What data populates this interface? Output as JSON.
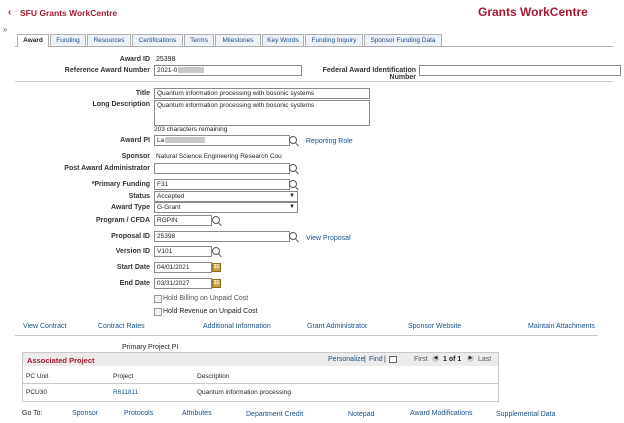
{
  "header": {
    "back_icon": "chevron-left-icon",
    "app_title": "SFU Grants WorkCentre",
    "right_title": "Grants WorkCentre",
    "collapse_glyph": "»",
    "brand_color": "#a6192e"
  },
  "tabs": [
    "Award",
    "Funding",
    "Resources",
    "Certifications",
    "Terms",
    "Milestones",
    "Key Words",
    "Funding Inquiry",
    "Sponsor Funding Data"
  ],
  "award": {
    "award_id_label": "Award ID",
    "award_id": "25398",
    "reference_label": "Reference Award Number",
    "reference_value": "2021-0",
    "federal_label": "Federal Award Identification Number",
    "federal_value": "",
    "title_label": "Title",
    "title_value": "Quantum information processing with bosonic systems",
    "long_desc_label": "Long Description",
    "long_desc_value": "Quantum information processing with bosonic systems",
    "chars_remaining": "203 characters remaining",
    "award_pi_label": "Award PI",
    "award_pi_value": "La",
    "reporting_role_link": "Reporting Role",
    "sponsor_label": "Sponsor",
    "sponsor_value": "Natural Science Engineering Research Cou",
    "post_award_label": "Post Award Administrator",
    "post_award_value": "",
    "primary_funding_label": "*Primary Funding",
    "primary_funding_value": "F31",
    "status_label": "Status",
    "status_value": "Accepted",
    "award_type_label": "Award Type",
    "award_type_value": "G-Grant",
    "program_label": "Program / CFDA",
    "program_value": "RGPIN",
    "proposal_label": "Proposal ID",
    "proposal_value": "25398",
    "view_proposal_link": "View Proposal",
    "version_label": "Version ID",
    "version_value": "V101",
    "start_label": "Start Date",
    "start_value": "04/01/2021",
    "end_label": "End Date",
    "end_value": "03/31/2027",
    "hold_billing": "Hold Billing on Unpaid Cost",
    "hold_revenue": "Hold Revenue on Unpaid Cost"
  },
  "links": [
    "View Contract",
    "Contract Rates",
    "Additional Information",
    "Grant Administrator",
    "Sponsor Website",
    "Maintain Attachments"
  ],
  "primary_project_pi_label": "Primary Project PI",
  "associated": {
    "title": "Associated Project",
    "personalize": "Personalize",
    "separator": "|",
    "find": "Find",
    "first": "First",
    "count": "1 of 1",
    "last": "Last",
    "columns": [
      "PC Unit",
      "Project",
      "Description"
    ],
    "rows": [
      {
        "pc_unit": "PCU30",
        "project": "R611811",
        "description": "Quantum information processing"
      }
    ]
  },
  "goto": {
    "label": "Go To:",
    "items": [
      "Sponsor",
      "Protocols",
      "Attributes",
      "Department Credit",
      "Notepad",
      "Award Modifications",
      "Supplemental Data"
    ]
  }
}
